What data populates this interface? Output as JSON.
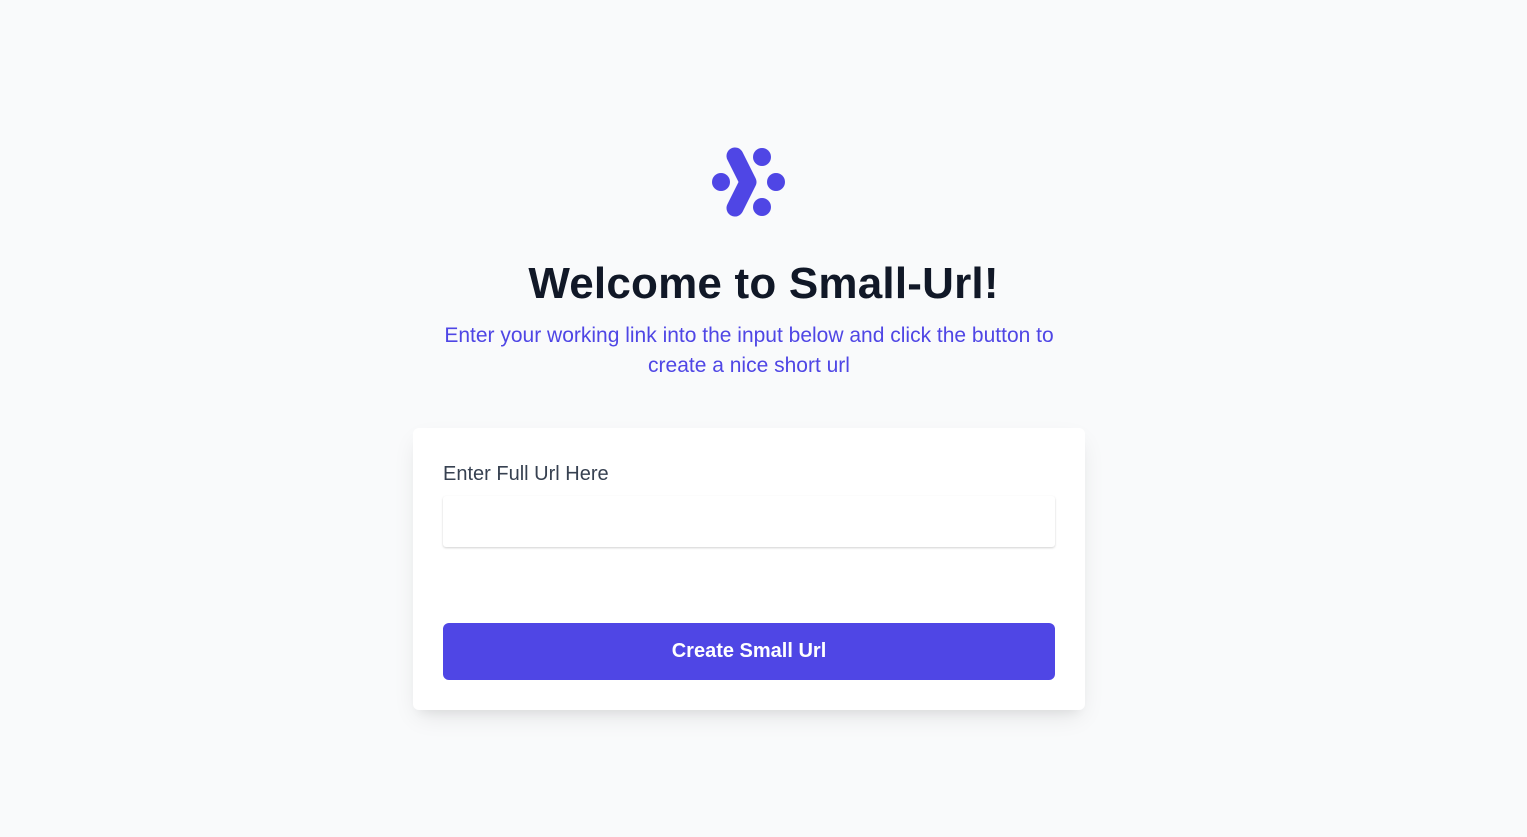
{
  "brand": {
    "logo_icon": "share-nodes-logo-icon",
    "accent_color": "#4f46e5"
  },
  "hero": {
    "title": "Welcome to Small-Url!",
    "subtitle": "Enter your working link into the input below and click the button to create a nice short url"
  },
  "form": {
    "label": "Enter Full Url Here",
    "input_value": "",
    "input_placeholder": "",
    "button_label": "Create Small Url"
  }
}
